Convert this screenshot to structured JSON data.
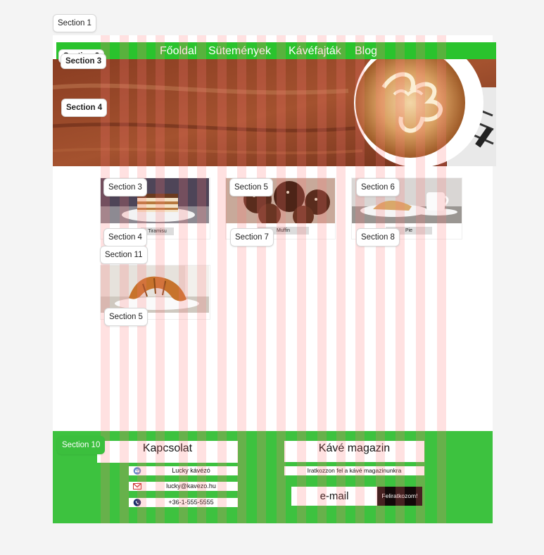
{
  "sections": {
    "s1": "Section 1",
    "s2": "Section 2",
    "s3_top": "Section 3",
    "s4_hero": "Section 4",
    "s3_card": "Section 3",
    "s5_card": "Section 5",
    "s6_card": "Section 6",
    "s4_label": "Section 4",
    "s7_label": "Section 7",
    "s8_label": "Section 8",
    "s11": "Section 11",
    "s5_bottom": "Section 5",
    "s10": "Section 10"
  },
  "nav": {
    "items": [
      "Főoldal",
      "Sütemények",
      "Kávéfajták",
      "Blog"
    ]
  },
  "cards": [
    {
      "label": "Tiramisu"
    },
    {
      "label": "Muffin"
    },
    {
      "label": "Pie"
    }
  ],
  "footer": {
    "contact_title": "Kapcsolat",
    "contact_name": "Lucky kávézó",
    "contact_email": "lucky@kavezo.hu",
    "contact_phone": "+36-1-555-5555",
    "magazine_title": "Kávé magazin",
    "magazine_sub": "Iratkozzon fel a kávé magazinunkra",
    "email_placeholder": "e-mail",
    "subscribe_label": "Feliratkozom!"
  },
  "colors": {
    "nav_green": "#2ac32d",
    "footer_green": "#3dc23f",
    "button_dark": "#120909",
    "grid_overlay": "#ff7878"
  }
}
